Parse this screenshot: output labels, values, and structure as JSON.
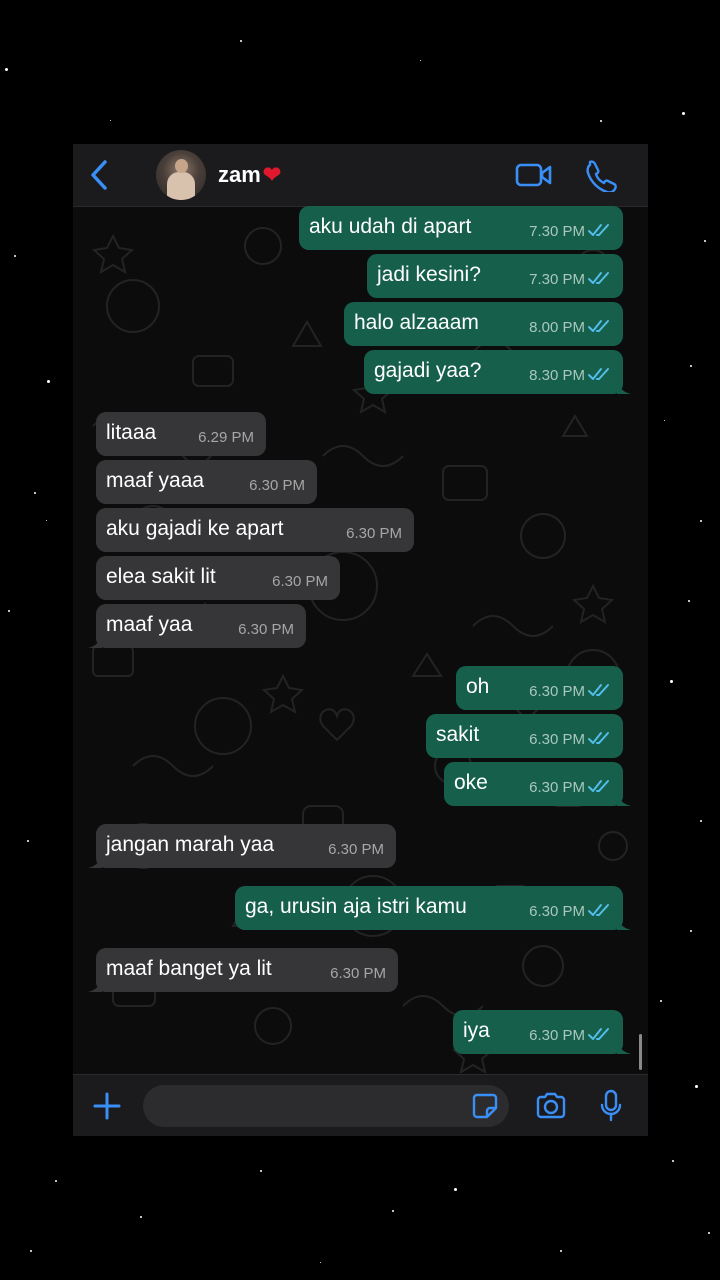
{
  "header": {
    "contact_name": "zam",
    "heart": "❤"
  },
  "messages": [
    {
      "dir": "out",
      "text": "aku udah di apart",
      "time": "7.30 PM"
    },
    {
      "dir": "out",
      "text": "jadi kesini?",
      "time": "7.30 PM"
    },
    {
      "dir": "out",
      "text": "halo alzaaam",
      "time": "8.00 PM"
    },
    {
      "dir": "out",
      "text": "gajadi yaa?",
      "time": "8.30 PM"
    },
    {
      "dir": "in",
      "text": "litaaa",
      "time": "6.29 PM"
    },
    {
      "dir": "in",
      "text": "maaf yaaa",
      "time": "6.30 PM"
    },
    {
      "dir": "in",
      "text": "aku gajadi ke apart",
      "time": "6.30 PM"
    },
    {
      "dir": "in",
      "text": "elea sakit lit",
      "time": "6.30 PM"
    },
    {
      "dir": "in",
      "text": "maaf yaa",
      "time": "6.30 PM"
    },
    {
      "dir": "out",
      "text": "oh",
      "time": "6.30 PM"
    },
    {
      "dir": "out",
      "text": "sakit",
      "time": "6.30 PM"
    },
    {
      "dir": "out",
      "text": "oke",
      "time": "6.30 PM"
    },
    {
      "dir": "in",
      "text": "jangan marah yaa",
      "time": "6.30 PM"
    },
    {
      "dir": "out",
      "text": "ga, urusin aja istri kamu",
      "time": "6.30 PM"
    },
    {
      "dir": "in",
      "text": "maaf banget ya lit",
      "time": "6.30 PM"
    },
    {
      "dir": "out",
      "text": "iya",
      "time": "6.30 PM"
    }
  ],
  "composer": {
    "input_value": ""
  },
  "colors": {
    "outgoing_bubble": "#16604b",
    "incoming_bubble": "#363638",
    "accent_blue": "#3a8ff7",
    "read_ticks": "#53bdeb"
  },
  "icons": [
    "back-chevron-icon",
    "video-call-icon",
    "phone-call-icon",
    "plus-icon",
    "sticker-icon",
    "camera-icon",
    "microphone-icon",
    "double-check-icon"
  ]
}
